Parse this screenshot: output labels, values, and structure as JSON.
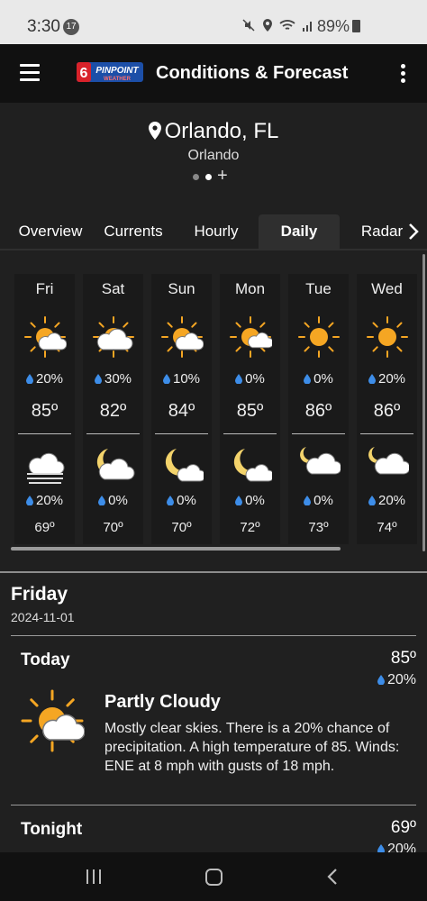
{
  "status_bar": {
    "time": "3:30",
    "notification_badge": "17",
    "system_icons": [
      "mute-icon",
      "location-icon",
      "wifi-icon",
      "signal-icon"
    ],
    "battery": "89%"
  },
  "app_bar": {
    "title": "Conditions & Forecast",
    "logo_text": "PINPOINT",
    "logo_sub": "WEATHER",
    "logo_number": "6"
  },
  "location": {
    "title": "Orlando, FL",
    "subtitle": "Orlando",
    "add_symbol": "+"
  },
  "tabs": [
    {
      "label": "Overview",
      "active": false
    },
    {
      "label": "Currents",
      "active": false
    },
    {
      "label": "Hourly",
      "active": false
    },
    {
      "label": "Daily",
      "active": true
    },
    {
      "label": "Radar",
      "active": false
    }
  ],
  "daily": [
    {
      "day": "Fri",
      "day_icon": "partly-cloudy-icon",
      "day_pop": "20%",
      "high": "85º",
      "night_icon": "fog-icon",
      "night_pop": "20%",
      "low": "69º"
    },
    {
      "day": "Sat",
      "day_icon": "mostly-cloudy-icon",
      "day_pop": "30%",
      "high": "82º",
      "night_icon": "partly-cloudy-night-icon",
      "night_pop": "0%",
      "low": "70º"
    },
    {
      "day": "Sun",
      "day_icon": "partly-cloudy-icon",
      "day_pop": "10%",
      "high": "84º",
      "night_icon": "mostly-clear-night-icon",
      "night_pop": "0%",
      "low": "70º"
    },
    {
      "day": "Mon",
      "day_icon": "mostly-sunny-icon",
      "day_pop": "0%",
      "high": "85º",
      "night_icon": "mostly-clear-night-icon",
      "night_pop": "0%",
      "low": "72º"
    },
    {
      "day": "Tue",
      "day_icon": "sunny-icon",
      "day_pop": "0%",
      "high": "86º",
      "night_icon": "partly-cloudy-night-icon",
      "night_pop": "0%",
      "low": "73º"
    },
    {
      "day": "Wed",
      "day_icon": "sunny-icon",
      "day_pop": "20%",
      "high": "86º",
      "night_icon": "partly-cloudy-night-icon",
      "night_pop": "20%",
      "low": "74º"
    }
  ],
  "detail": {
    "day_name": "Friday",
    "date": "2024-11-01",
    "today": {
      "label": "Today",
      "temp": "85º",
      "pop": "20%",
      "icon": "partly-cloudy-icon",
      "condition": "Partly Cloudy",
      "description": "Mostly clear skies. There is a 20% chance of precipitation. A high temperature of 85. Winds: ENE at 8 mph with gusts of 18 mph."
    },
    "tonight": {
      "label": "Tonight",
      "temp": "69º",
      "pop": "20%"
    }
  },
  "colors": {
    "background": "#202020",
    "header": "#111111",
    "sun": "#f5a623",
    "drop": "#3d8de8",
    "logo_red": "#d9222a",
    "logo_blue": "#1c4fa8"
  }
}
